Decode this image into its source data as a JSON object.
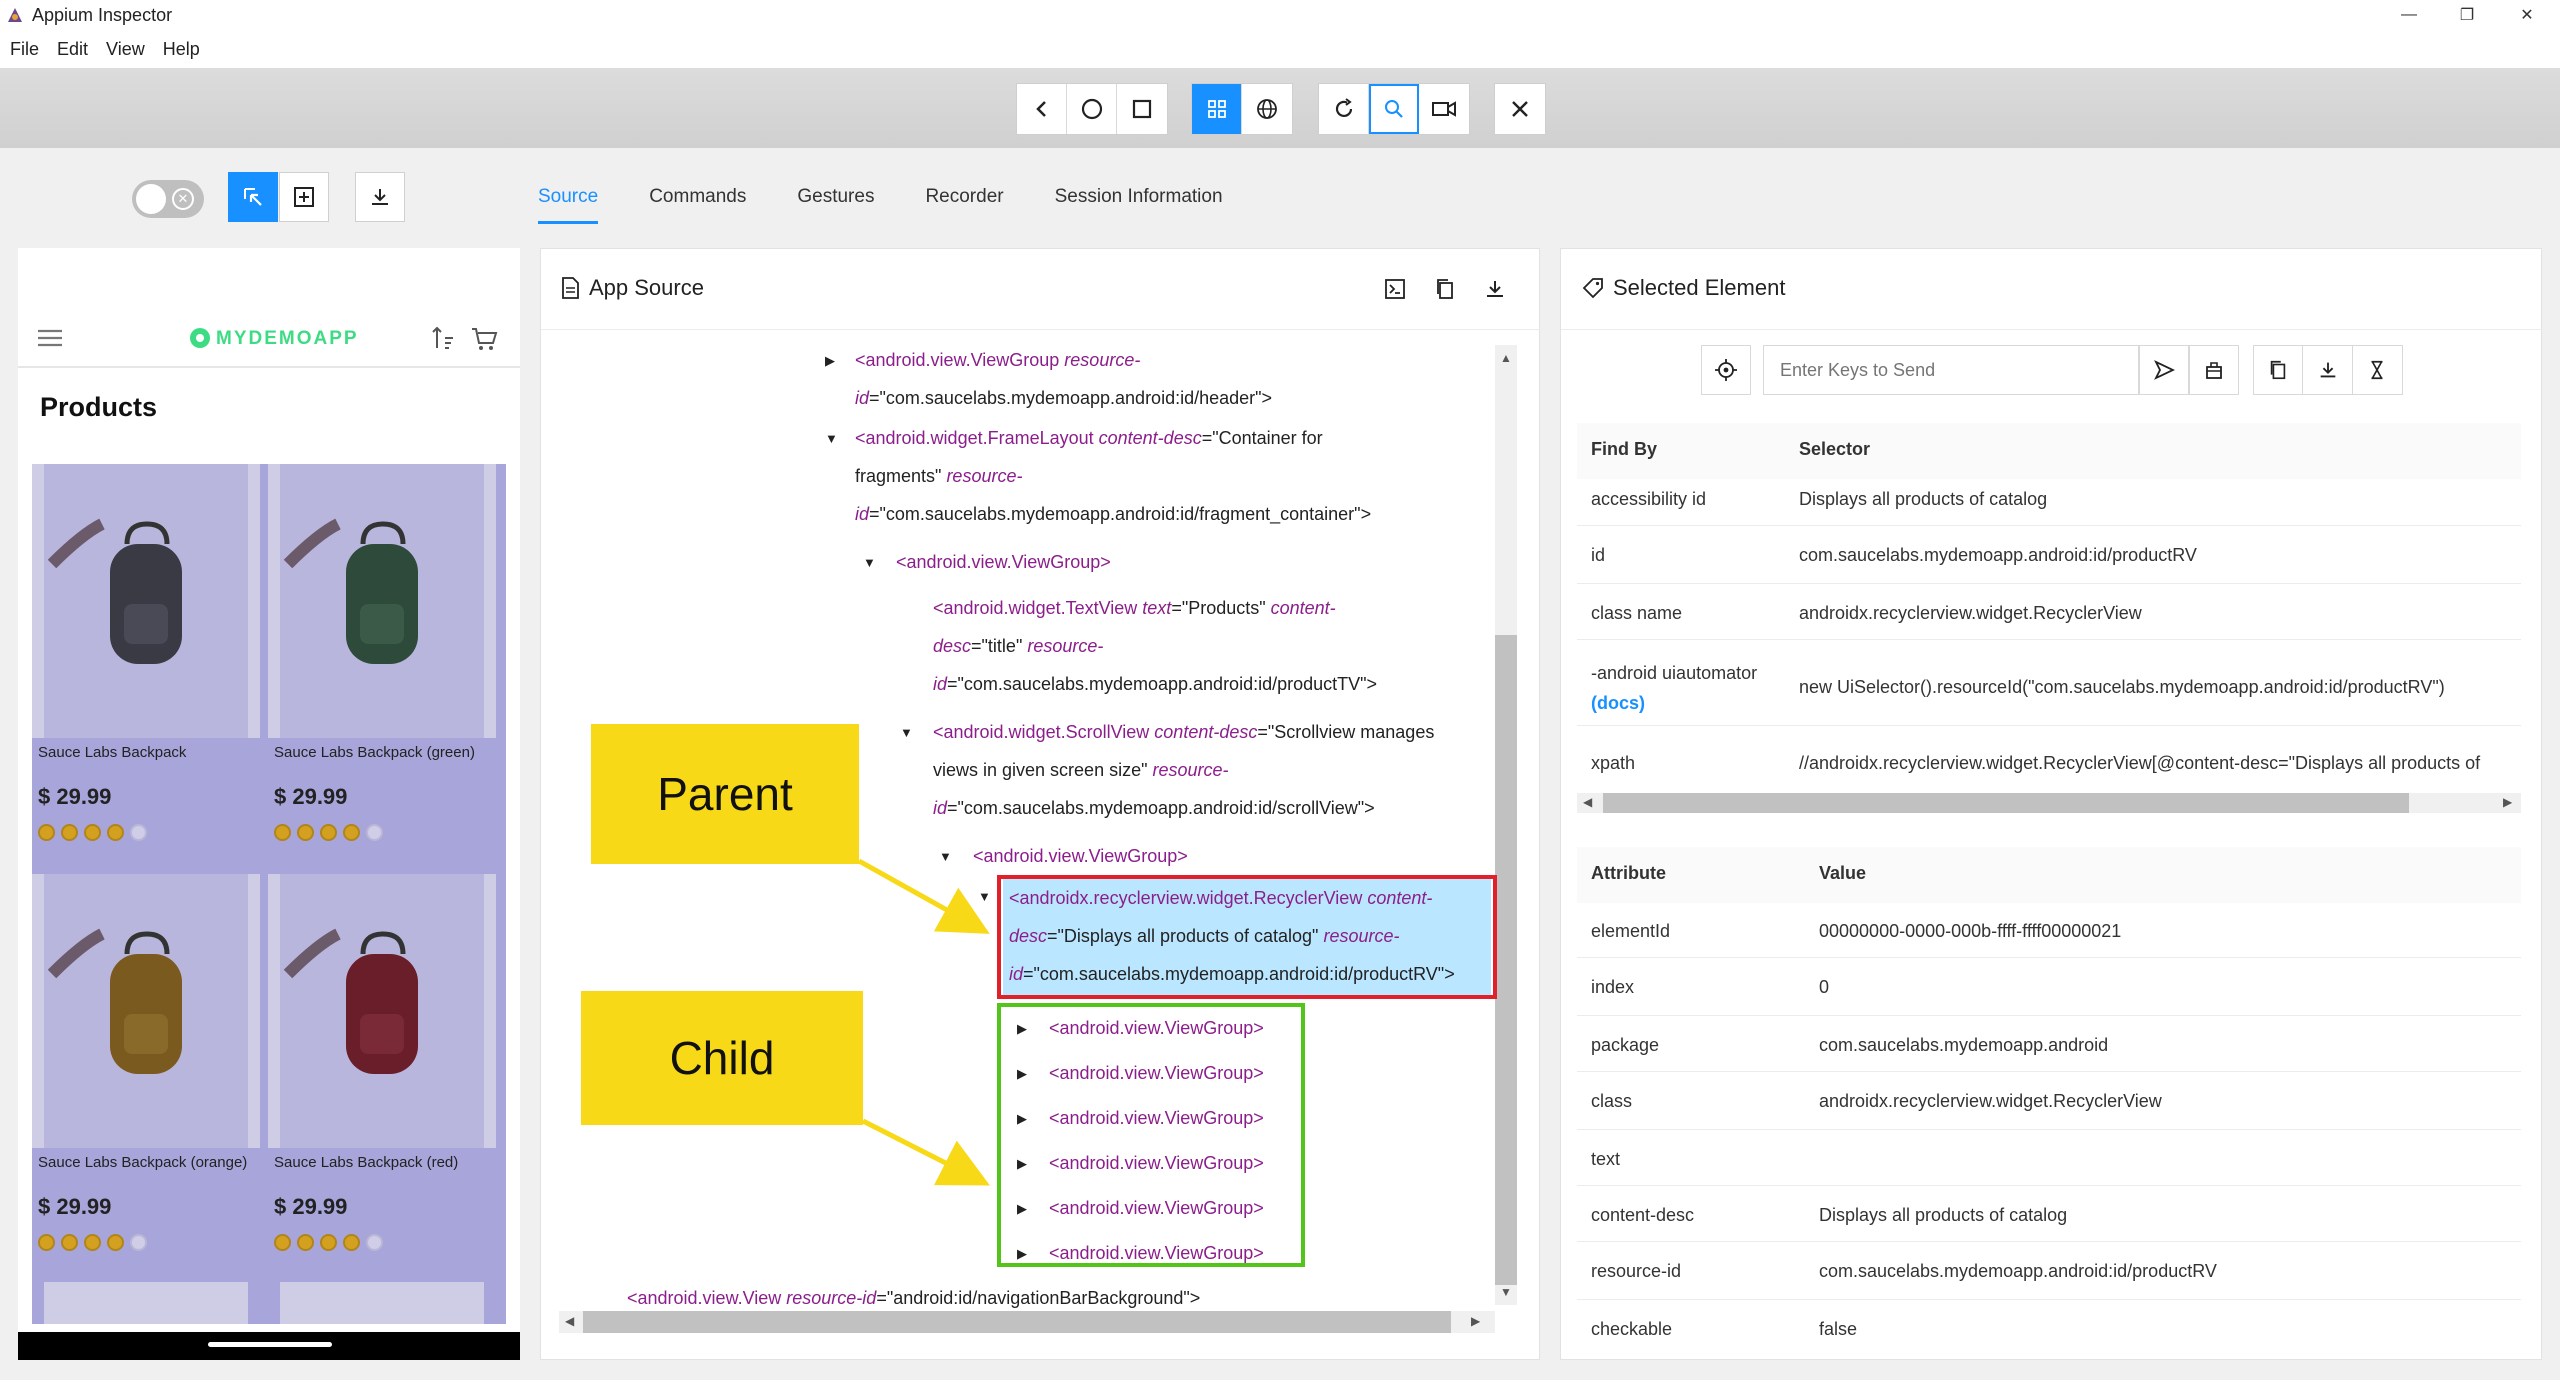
{
  "window": {
    "title": "Appium Inspector",
    "controls": [
      "—",
      "❐",
      "✕"
    ]
  },
  "menu": [
    "File",
    "Edit",
    "View",
    "Help"
  ],
  "toolbar": {
    "nav_buttons": [
      "back-icon",
      "home-icon",
      "app-switch-icon"
    ],
    "mode_buttons": [
      "native-mode-icon",
      "web-mode-icon"
    ],
    "action_buttons": [
      "refresh-icon",
      "search-icon",
      "record-icon"
    ],
    "quit_button": "close-icon"
  },
  "left_controls": {
    "toggle": "off"
  },
  "tabs": [
    "Source",
    "Commands",
    "Gestures",
    "Recorder",
    "Session Information"
  ],
  "active_tab": "Source",
  "device": {
    "app_name": "MYDEMOAPP",
    "page_title": "Products",
    "products": [
      {
        "name": "Sauce Labs Backpack",
        "price": "$ 29.99",
        "rating": 4,
        "color": "#3a3a44"
      },
      {
        "name": "Sauce Labs Backpack (green)",
        "price": "$ 29.99",
        "rating": 4,
        "color": "#2e4a3a"
      },
      {
        "name": "Sauce Labs Backpack (orange)",
        "price": "$ 29.99",
        "rating": 4,
        "color": "#7a5a1e"
      },
      {
        "name": "Sauce Labs Backpack (red)",
        "price": "$ 29.99",
        "rating": 4,
        "color": "#6a1e2a"
      }
    ]
  },
  "source": {
    "title": "App Source",
    "lines": {
      "l1a": "<android.view.ViewGroup",
      "l1b": " resource-",
      "l1c": "id",
      "l1d": "=\"com.saucelabs.mydemoapp.android:id/header\">",
      "l2a": "<android.widget.FrameLayout",
      "l2b": " content-desc",
      "l2c": "=\"Container for",
      "l2d": "fragments\"",
      "l2e": " resource-",
      "l2f": "id",
      "l2g": "=\"com.saucelabs.mydemoapp.android:id/fragment_container\">",
      "l3": "<android.view.ViewGroup>",
      "l4a": "<android.widget.TextView",
      "l4b": " text",
      "l4c": "=\"Products\"",
      "l4d": " content-",
      "l4e": "desc",
      "l4f": "=\"title\"",
      "l4g": " resource-",
      "l4h": "id",
      "l4i": "=\"com.saucelabs.mydemoapp.android:id/productTV\">",
      "l5a": "<android.widget.ScrollView",
      "l5b": " content-desc",
      "l5c": "=\"Scrollview manages",
      "l5d": "views in given screen size\"",
      "l5e": " resource-",
      "l5f": "id",
      "l5g": "=\"com.saucelabs.mydemoapp.android:id/scrollView\">",
      "l6": "<android.view.ViewGroup>",
      "l7a": "<androidx.recyclerview.widget.RecyclerView",
      "l7b": " content-",
      "l7c": "desc",
      "l7d": "=\"Displays all products of catalog\"",
      "l7e": " resource-",
      "l7f": "id",
      "l7g": "=\"com.saucelabs.mydemoapp.android:id/productRV\">",
      "child": "<android.view.ViewGroup>",
      "l9a": "<android.view.View",
      "l9b": " resource-id",
      "l9c": "=\"android:id/navigationBarBackground\">"
    },
    "child_count": 6
  },
  "callouts": {
    "parent": "Parent",
    "child": "Child"
  },
  "selected": {
    "title": "Selected Element",
    "keys_placeholder": "Enter Keys to Send",
    "find_header": {
      "k": "Find By",
      "v": "Selector"
    },
    "find": [
      {
        "k": "accessibility id",
        "v": "Displays all products of catalog"
      },
      {
        "k": "id",
        "v": "com.saucelabs.mydemoapp.android:id/productRV"
      },
      {
        "k": "class name",
        "v": "androidx.recyclerview.widget.RecyclerView"
      },
      {
        "k": "-android uiautomator",
        "k2": "(docs)",
        "v": "new UiSelector().resourceId(\"com.saucelabs.mydemoapp.android:id/productRV\")"
      },
      {
        "k": "xpath",
        "v": "//androidx.recyclerview.widget.RecyclerView[@content-desc=\"Displays all products of"
      }
    ],
    "attr_header": {
      "k": "Attribute",
      "v": "Value"
    },
    "attrs": [
      {
        "k": "elementId",
        "v": "00000000-0000-000b-ffff-ffff00000021"
      },
      {
        "k": "index",
        "v": "0"
      },
      {
        "k": "package",
        "v": "com.saucelabs.mydemoapp.android"
      },
      {
        "k": "class",
        "v": "androidx.recyclerview.widget.RecyclerView"
      },
      {
        "k": "text",
        "v": ""
      },
      {
        "k": "content-desc",
        "v": "Displays all products of catalog"
      },
      {
        "k": "resource-id",
        "v": "com.saucelabs.mydemoapp.android:id/productRV"
      },
      {
        "k": "checkable",
        "v": "false"
      }
    ]
  },
  "colors": {
    "accent": "#1890ff",
    "highlight": "#bae7ff",
    "parent_box": "#e0202a",
    "child_box": "#52c41a",
    "callout": "#f7d917"
  }
}
